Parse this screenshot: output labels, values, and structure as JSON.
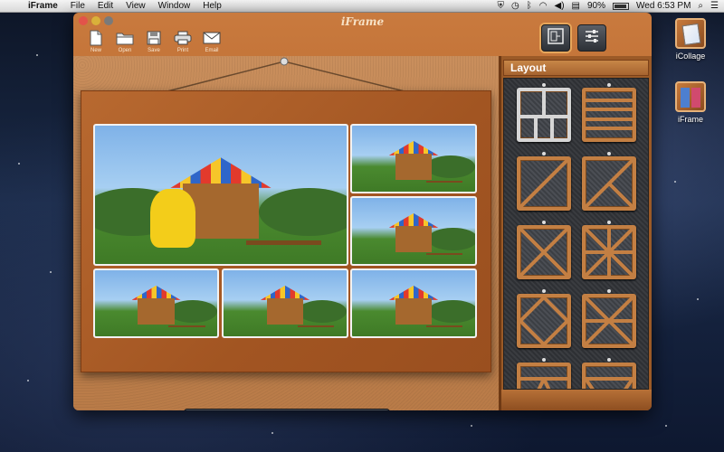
{
  "menubar": {
    "app_name": "iFrame",
    "menus": [
      "File",
      "Edit",
      "View",
      "Window",
      "Help"
    ],
    "battery": "90%",
    "datetime": "Wed 6:53 PM",
    "battery_level": 0.9
  },
  "window": {
    "title": "iFrame",
    "toolbar": [
      {
        "label": "New",
        "icon": "new-document-icon"
      },
      {
        "label": "Open",
        "icon": "folder-icon"
      },
      {
        "label": "Save",
        "icon": "floppy-disk-icon"
      },
      {
        "label": "Print",
        "icon": "printer-icon"
      },
      {
        "label": "Email",
        "icon": "envelope-icon"
      }
    ],
    "view_buttons": [
      {
        "name": "layout-view-button",
        "icon": "layout-icon",
        "active": true
      },
      {
        "name": "adjust-view-button",
        "icon": "sliders-icon",
        "active": false
      }
    ],
    "controls": [
      {
        "name": "undo-button",
        "icon": "undo-arrow-icon",
        "glyph": "↶"
      },
      {
        "name": "redo-button",
        "icon": "redo-arrow-icon",
        "glyph": "↷"
      },
      {
        "name": "delete-button",
        "icon": "trash-icon",
        "glyph": "🗑"
      },
      {
        "name": "swap-button",
        "icon": "swap-arrows-icon",
        "glyph": "⇄"
      },
      {
        "name": "rotate-button",
        "icon": "rotate-icon",
        "glyph": "⟲"
      },
      {
        "name": "flip-horizontal-button",
        "icon": "flip-horizontal-icon",
        "glyph": "◧"
      },
      {
        "name": "flip-vertical-button",
        "icon": "flip-vertical-icon",
        "glyph": "⬒"
      },
      {
        "name": "power-button",
        "icon": "power-icon",
        "glyph": "⏻"
      }
    ]
  },
  "layout_panel": {
    "title": "Layout",
    "selected_index": 0
  },
  "desktop_icons": [
    {
      "label": "iCollage",
      "icon": "icollage-app-icon"
    },
    {
      "label": "iFrame",
      "icon": "iframe-app-icon"
    }
  ]
}
